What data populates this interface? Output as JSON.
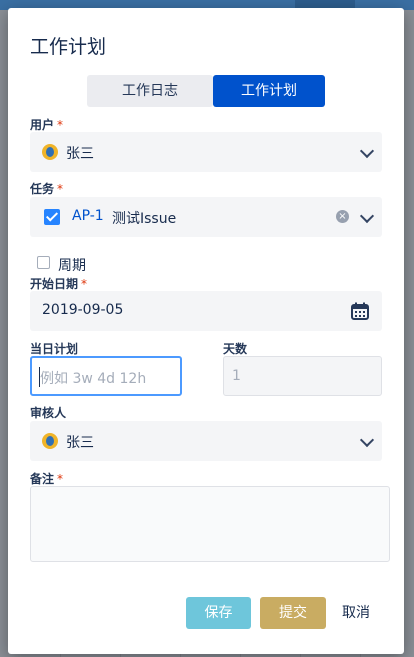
{
  "dialog": {
    "title": "工作计划"
  },
  "tabs": [
    {
      "label": "工作日志",
      "active": false
    },
    {
      "label": "工作计划",
      "active": true
    }
  ],
  "user_field": {
    "label": "用户",
    "required_mark": "*",
    "value": "张三"
  },
  "task_field": {
    "label": "任务",
    "required_mark": "*",
    "issue_key": "AP-1",
    "issue_summary": "测试Issue",
    "checked": true
  },
  "period": {
    "label": "周期",
    "checked": false
  },
  "start_date": {
    "label": "开始日期",
    "required_mark": "*",
    "value": "2019-09-05"
  },
  "daily_plan": {
    "label": "当日计划",
    "placeholder": "例如 3w 4d 12h"
  },
  "days": {
    "label": "天数",
    "placeholder": "1"
  },
  "reviewer": {
    "label": "审核人",
    "value": "张三"
  },
  "remark": {
    "label": "备注",
    "required_mark": "*"
  },
  "buttons": {
    "save": "保存",
    "submit": "提交",
    "cancel": "取消"
  },
  "colors": {
    "primary": "#0052cc",
    "save": "#6ec6db",
    "submit": "#c9ac62",
    "required": "#de350b"
  }
}
